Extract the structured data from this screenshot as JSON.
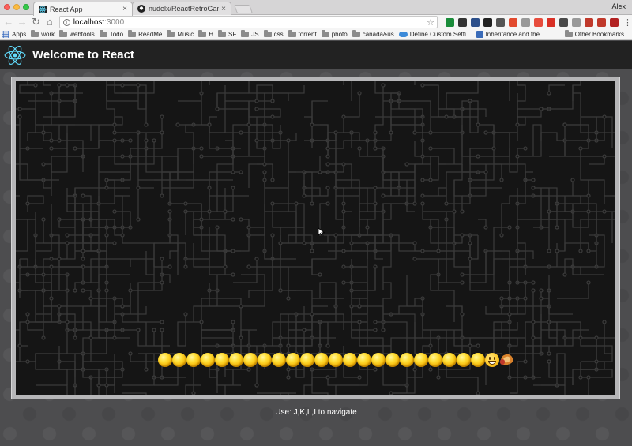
{
  "browser": {
    "tabs": [
      {
        "title": "React App",
        "active": true
      },
      {
        "title": "nudelx/ReactRetroGame-Emo",
        "active": false
      }
    ],
    "profile_name": "Alex",
    "address": {
      "host": "localhost",
      "port": ":3000"
    },
    "bookmarks": [
      {
        "label": "Apps",
        "icon": "apps-grid-icon"
      },
      {
        "label": "work",
        "icon": "folder-icon"
      },
      {
        "label": "webtools",
        "icon": "folder-icon"
      },
      {
        "label": "Todo",
        "icon": "folder-icon"
      },
      {
        "label": "ReadMe",
        "icon": "folder-icon"
      },
      {
        "label": "Music",
        "icon": "folder-icon"
      },
      {
        "label": "H",
        "icon": "folder-icon"
      },
      {
        "label": "SF",
        "icon": "folder-icon"
      },
      {
        "label": "JS",
        "icon": "folder-icon"
      },
      {
        "label": "css",
        "icon": "folder-icon"
      },
      {
        "label": "torrent",
        "icon": "folder-icon"
      },
      {
        "label": "photo",
        "icon": "folder-icon"
      },
      {
        "label": "canada&us",
        "icon": "folder-icon"
      },
      {
        "label": "Define Custom Setti...",
        "icon": "cloud-icon"
      },
      {
        "label": "Inheritance and the...",
        "icon": "note-icon"
      }
    ],
    "other_bookmarks": "Other Bookmarks",
    "extension_colors": [
      "#1a8c3a",
      "#333333",
      "#2c4f8a",
      "#222222",
      "#555555",
      "#e24a2e",
      "#999999",
      "#e74c3c",
      "#d93025",
      "#4a4a4a",
      "#999999",
      "#c0392b",
      "#c0392b",
      "#b22222"
    ]
  },
  "app": {
    "title": "Welcome to React",
    "react_color": "#61dafb"
  },
  "game": {
    "snake_body_count": 23,
    "hint": "Use: J,K,L,I to navigate"
  }
}
